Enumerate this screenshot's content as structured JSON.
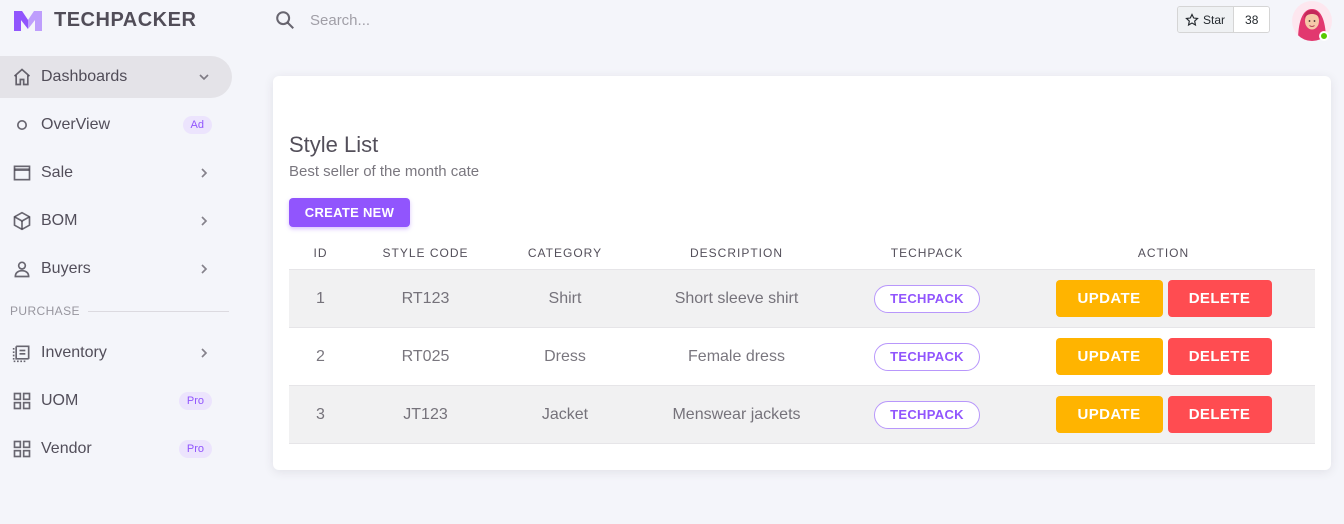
{
  "brand": {
    "name": "TECHPACKER",
    "color": "#9155fd"
  },
  "sidebar": {
    "items": [
      {
        "label": "Dashboards",
        "icon": "home-icon",
        "trailing": "chevron-down"
      },
      {
        "label": "OverView",
        "icon": "circle-icon",
        "badge": "Ad"
      },
      {
        "label": "Sale",
        "icon": "window-icon",
        "trailing": "chevron-right"
      },
      {
        "label": "BOM",
        "icon": "cube-icon",
        "trailing": "chevron-right"
      },
      {
        "label": "Buyers",
        "icon": "user-icon",
        "trailing": "chevron-right"
      }
    ],
    "section_label": "PURCHASE",
    "purchase_items": [
      {
        "label": "Inventory",
        "icon": "list-icon",
        "trailing": "chevron-right"
      },
      {
        "label": "UOM",
        "icon": "grid-icon",
        "badge": "Pro"
      },
      {
        "label": "Vendor",
        "icon": "grid-icon",
        "badge": "Pro"
      }
    ]
  },
  "topbar": {
    "search_placeholder": "Search...",
    "star_label": "Star",
    "star_count": "38"
  },
  "card": {
    "title": "Style List",
    "subtitle": "Best seller of the month cate",
    "create_label": "CREATE NEW",
    "columns": [
      "ID",
      "STYLE CODE",
      "CATEGORY",
      "DESCRIPTION",
      "TECHPACK",
      "ACTION"
    ],
    "rows": [
      {
        "id": "1",
        "code": "RT123",
        "category": "Shirt",
        "description": "Short sleeve shirt",
        "techpack": "TECHPACK",
        "update": "UPDATE",
        "delete": "DELETE"
      },
      {
        "id": "2",
        "code": "RT025",
        "category": "Dress",
        "description": "Female dress",
        "techpack": "TECHPACK",
        "update": "UPDATE",
        "delete": "DELETE"
      },
      {
        "id": "3",
        "code": "JT123",
        "category": "Jacket",
        "description": "Menswear jackets",
        "techpack": "TECHPACK",
        "update": "UPDATE",
        "delete": "DELETE"
      }
    ]
  },
  "colors": {
    "primary": "#9155fd",
    "warning": "#ffb400",
    "error": "#ff4c51",
    "online": "#56ca00"
  }
}
